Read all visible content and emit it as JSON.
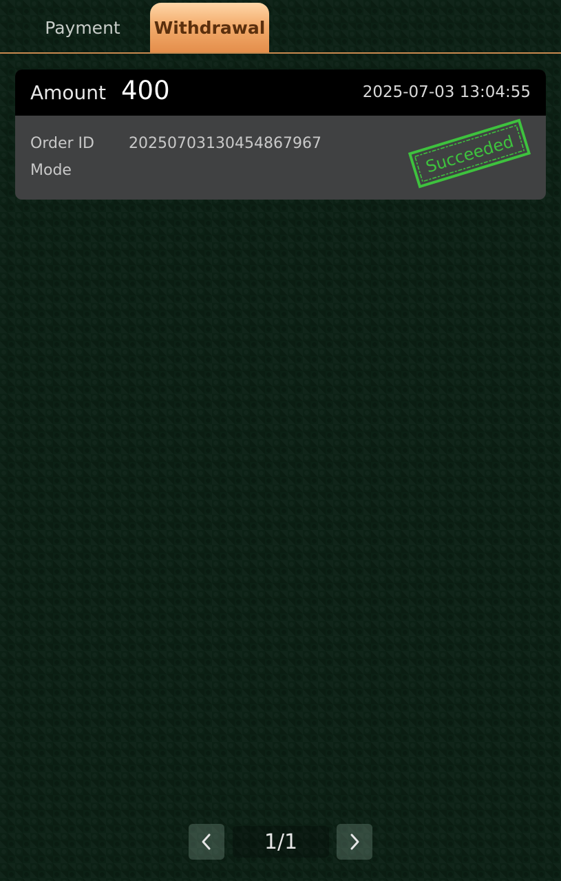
{
  "tabs": [
    {
      "label": "Payment",
      "active": false
    },
    {
      "label": "Withdrawal",
      "active": true
    }
  ],
  "records": [
    {
      "amount_label": "Amount",
      "amount": "400",
      "time": "2025-07-03 13:04:55",
      "order_id_label": "Order ID",
      "order_id": "20250703130454867967",
      "mode_label": "Mode",
      "mode": "",
      "status": "Succeeded",
      "status_color": "#3ec23e"
    }
  ],
  "pagination": {
    "indicator": "1/1",
    "prev_icon": "chevron-left-icon",
    "next_icon": "chevron-right-icon"
  },
  "colors": {
    "background": "#0c2115",
    "tab_active": "#f3ad6e",
    "tab_underline": "#c98a4f",
    "card_header": "#000000",
    "card_body": "#404142"
  }
}
